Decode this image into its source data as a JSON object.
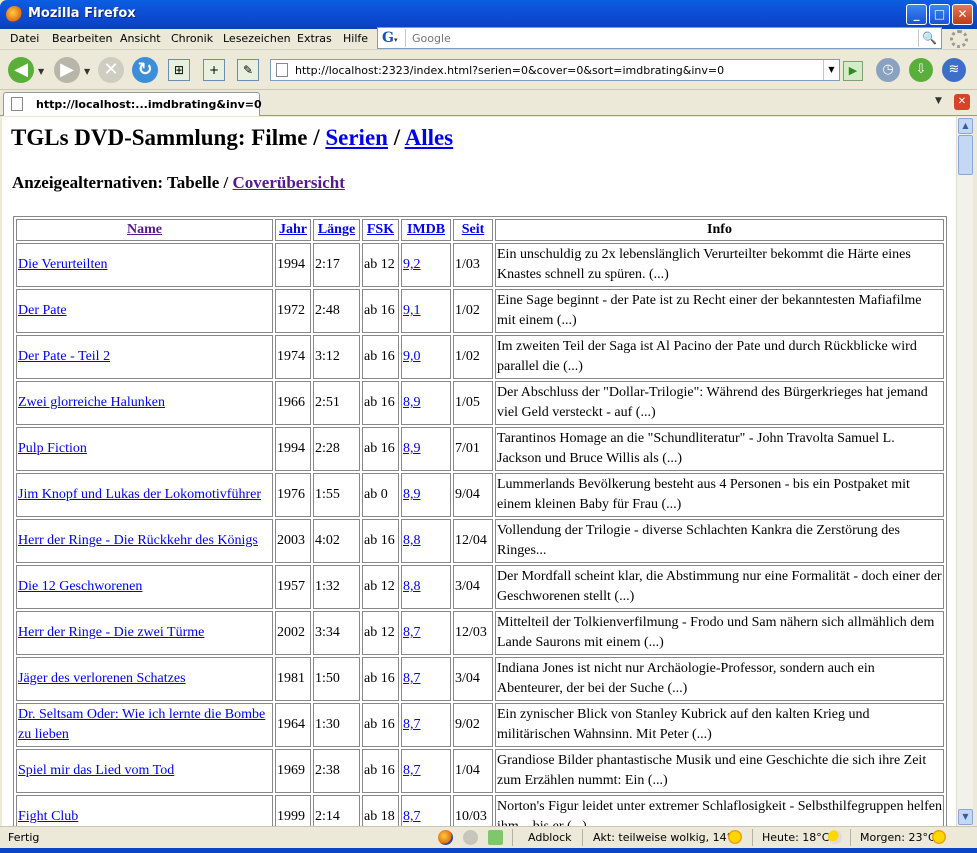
{
  "window": {
    "title": "Mozilla Firefox"
  },
  "menu": [
    "Datei",
    "Bearbeiten",
    "Ansicht",
    "Chronik",
    "Lesezeichen",
    "Extras",
    "Hilfe"
  ],
  "search": {
    "engine": "G",
    "placeholder": "Google"
  },
  "nav": {
    "url": "http://localhost:2323/index.html?serien=0&cover=0&sort=imdbrating&inv=0"
  },
  "tab": {
    "label": "http://localhost:...imdbrating&inv=0"
  },
  "page": {
    "title_prefix": "TGLs DVD-Sammlung: Filme / ",
    "link_series": "Serien",
    "sep": " / ",
    "link_all": "Alles",
    "alt_label": "Anzeigealternativen: Tabelle / ",
    "alt_link": "Coverübersicht"
  },
  "table": {
    "headers": {
      "name": "Name",
      "jahr": "Jahr",
      "laenge": "Länge",
      "fsk": "FSK",
      "imdb": "IMDB",
      "seit": "Seit",
      "info": "Info"
    },
    "rows": [
      {
        "name": "Die Verurteilten",
        "jahr": "1994",
        "laenge": "2:17",
        "fsk": "ab 12",
        "imdb": "9,2",
        "seit": "1/03",
        "info": "Ein unschuldig zu 2x lebenslänglich Verurteilter bekommt die Härte eines Knastes schnell zu spüren. (...)"
      },
      {
        "name": "Der Pate",
        "jahr": "1972",
        "laenge": "2:48",
        "fsk": "ab 16",
        "imdb": "9,1",
        "seit": "1/02",
        "info": "Eine Sage beginnt - der Pate ist zu Recht einer der bekanntesten Mafiafilme mit einem (...)"
      },
      {
        "name": "Der Pate - Teil 2",
        "jahr": "1974",
        "laenge": "3:12",
        "fsk": "ab 16",
        "imdb": "9,0",
        "seit": "1/02",
        "info": "Im zweiten Teil der Saga ist Al Pacino der Pate und durch Rückblicke wird parallel die (...)"
      },
      {
        "name": "Zwei glorreiche Halunken",
        "jahr": "1966",
        "laenge": "2:51",
        "fsk": "ab 16",
        "imdb": "8,9",
        "seit": "1/05",
        "info": "Der Abschluss der \"Dollar-Trilogie\": Während des Bürgerkrieges hat jemand viel Geld versteckt - auf (...)"
      },
      {
        "name": "Pulp Fiction",
        "jahr": "1994",
        "laenge": "2:28",
        "fsk": "ab 16",
        "imdb": "8,9",
        "seit": "7/01",
        "info": "Tarantinos Homage an die \"Schundliteratur\" - John Travolta Samuel L. Jackson und Bruce Willis als (...)"
      },
      {
        "name": "Jim Knopf und Lukas der Lokomotivführer",
        "jahr": "1976",
        "laenge": "1:55",
        "fsk": "ab 0",
        "imdb": "8,9",
        "seit": "9/04",
        "info": "Lummerlands Bevölkerung besteht aus 4 Personen - bis ein Postpaket mit einem kleinen Baby für Frau (...)"
      },
      {
        "name": "Herr der Ringe - Die Rückkehr des Königs",
        "jahr": "2003",
        "laenge": "4:02",
        "fsk": "ab 16",
        "imdb": "8,8",
        "seit": "12/04",
        "info": "Vollendung der Trilogie - diverse Schlachten Kankra die Zerstörung des Ringes..."
      },
      {
        "name": "Die 12 Geschworenen",
        "jahr": "1957",
        "laenge": "1:32",
        "fsk": "ab 12",
        "imdb": "8,8",
        "seit": "3/04",
        "info": "Der Mordfall scheint klar, die Abstimmung nur eine Formalität - doch einer der Geschworenen stellt (...)"
      },
      {
        "name": "Herr der Ringe - Die zwei Türme",
        "jahr": "2002",
        "laenge": "3:34",
        "fsk": "ab 12",
        "imdb": "8,7",
        "seit": "12/03",
        "info": "Mittelteil der Tolkienverfilmung - Frodo und Sam nähern sich allmählich dem Lande Saurons mit einem (...)"
      },
      {
        "name": "Jäger des verlorenen Schatzes",
        "jahr": "1981",
        "laenge": "1:50",
        "fsk": "ab 16",
        "imdb": "8,7",
        "seit": "3/04",
        "info": "Indiana Jones ist nicht nur Archäologie-Professor, sondern auch ein Abenteurer, der bei der Suche (...)"
      },
      {
        "name": "Dr. Seltsam Oder: Wie ich lernte die Bombe zu lieben",
        "jahr": "1964",
        "laenge": "1:30",
        "fsk": "ab 16",
        "imdb": "8,7",
        "seit": "9/02",
        "info": "Ein zynischer Blick von Stanley Kubrick auf den kalten Krieg und militärischen Wahnsinn. Mit Peter (...)"
      },
      {
        "name": "Spiel mir das Lied vom Tod",
        "jahr": "1969",
        "laenge": "2:38",
        "fsk": "ab 16",
        "imdb": "8,7",
        "seit": "1/04",
        "info": "Grandiose Bilder phantastische Musik und eine Geschichte die sich ihre Zeit zum Erzählen nummt: Ein (...)"
      },
      {
        "name": "Fight Club",
        "jahr": "1999",
        "laenge": "2:14",
        "fsk": "ab 18",
        "imdb": "8,7",
        "seit": "10/03",
        "info": "Norton's Figur leidet unter extremer Schlaflosigkeit - Selbsthilfegruppen helfen ihm... bis er (...)"
      }
    ]
  },
  "status": {
    "left": "Fertig",
    "adblock": "Adblock",
    "weather_now": "Akt: teilweise wolkig, 14°C",
    "weather_today": "Heute: 18°C",
    "weather_tomorrow": "Morgen: 23°C"
  }
}
